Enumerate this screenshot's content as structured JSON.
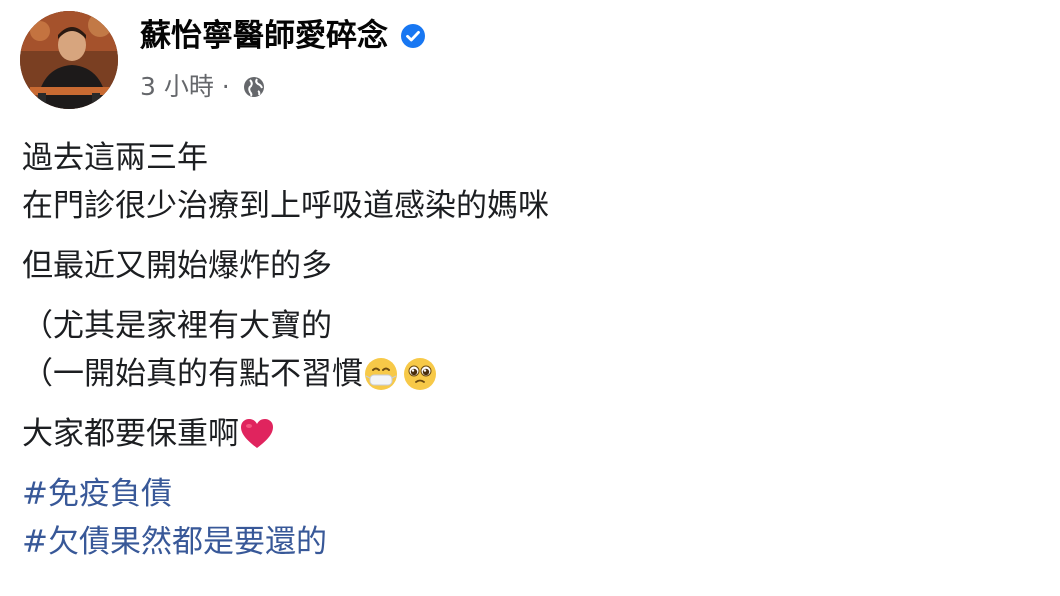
{
  "post": {
    "author": "蘇怡寧醫師愛碎念",
    "time": "3 小時",
    "separator": " · ",
    "lines": [
      "過去這兩三年",
      "在門診很少治療到上呼吸道感染的媽咪",
      "但最近又開始爆炸的多",
      "（尤其是家裡有大寶的",
      "（一開始真的有點不習慣",
      "大家都要保重啊"
    ],
    "hashtags": [
      "#免疫負債",
      "#欠債果然都是要還的"
    ],
    "icons": {
      "verified": "verified-badge-icon",
      "audience": "globe-icon",
      "emoji_1": "sick-face-emoji",
      "emoji_2": "pleading-face-emoji",
      "emoji_3": "red-heart-emoji"
    },
    "colors": {
      "verified": "#1877f2",
      "hashtag": "#385898",
      "meta": "#65676b"
    }
  }
}
